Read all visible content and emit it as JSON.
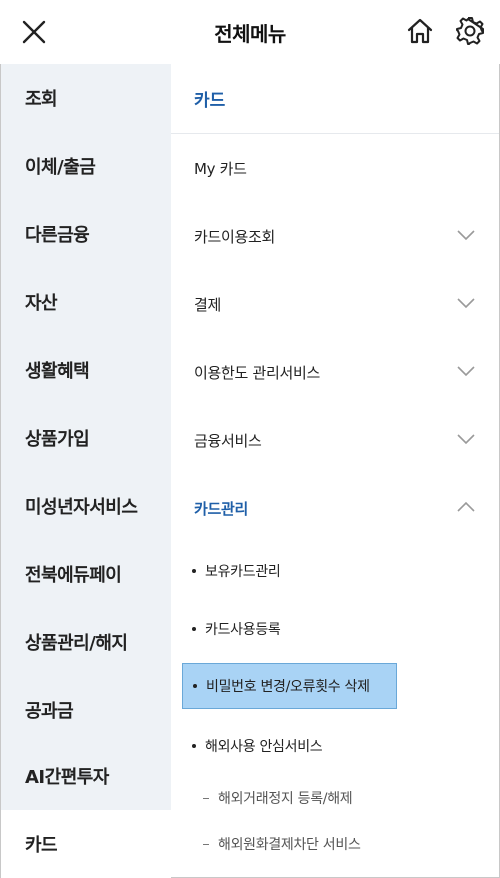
{
  "header": {
    "title": "전체메뉴",
    "close_icon": "close-icon",
    "home_icon": "home-icon",
    "settings_icon": "gear-icon"
  },
  "sidebar": {
    "items": [
      {
        "label": "조회"
      },
      {
        "label": "이체/출금"
      },
      {
        "label": "다른금융"
      },
      {
        "label": "자산"
      },
      {
        "label": "생활혜택"
      },
      {
        "label": "상품가입"
      },
      {
        "label": "미성년자서비스"
      },
      {
        "label": "전북에듀페이"
      },
      {
        "label": "상품관리/해지"
      },
      {
        "label": "공과금"
      },
      {
        "label": "AI간편투자"
      },
      {
        "label": "카드"
      }
    ],
    "active": "카드"
  },
  "content": {
    "section_title": "카드",
    "menus": [
      {
        "label": "My 카드",
        "expandable": false
      },
      {
        "label": "카드이용조회",
        "expandable": true,
        "expanded": false
      },
      {
        "label": "결제",
        "expandable": true,
        "expanded": false
      },
      {
        "label": "이용한도 관리서비스",
        "expandable": true,
        "expanded": false
      },
      {
        "label": "금융서비스",
        "expandable": true,
        "expanded": false
      },
      {
        "label": "카드관리",
        "expandable": true,
        "expanded": true
      }
    ],
    "submenu": [
      {
        "label": "보유카드관리"
      },
      {
        "label": "카드사용등록"
      },
      {
        "label": "비밀번호 변경/오류횟수 삭제",
        "selected": true
      },
      {
        "label": "해외사용 안심서비스"
      }
    ],
    "subsubmenu": [
      {
        "label": "해외거래정지 등록/해제"
      },
      {
        "label": "해외원화결제차단 서비스"
      }
    ]
  },
  "colors": {
    "accent": "#1f5fa8",
    "sidebar_bg": "#eef2f6",
    "selected_bg": "#a9d3f5"
  }
}
